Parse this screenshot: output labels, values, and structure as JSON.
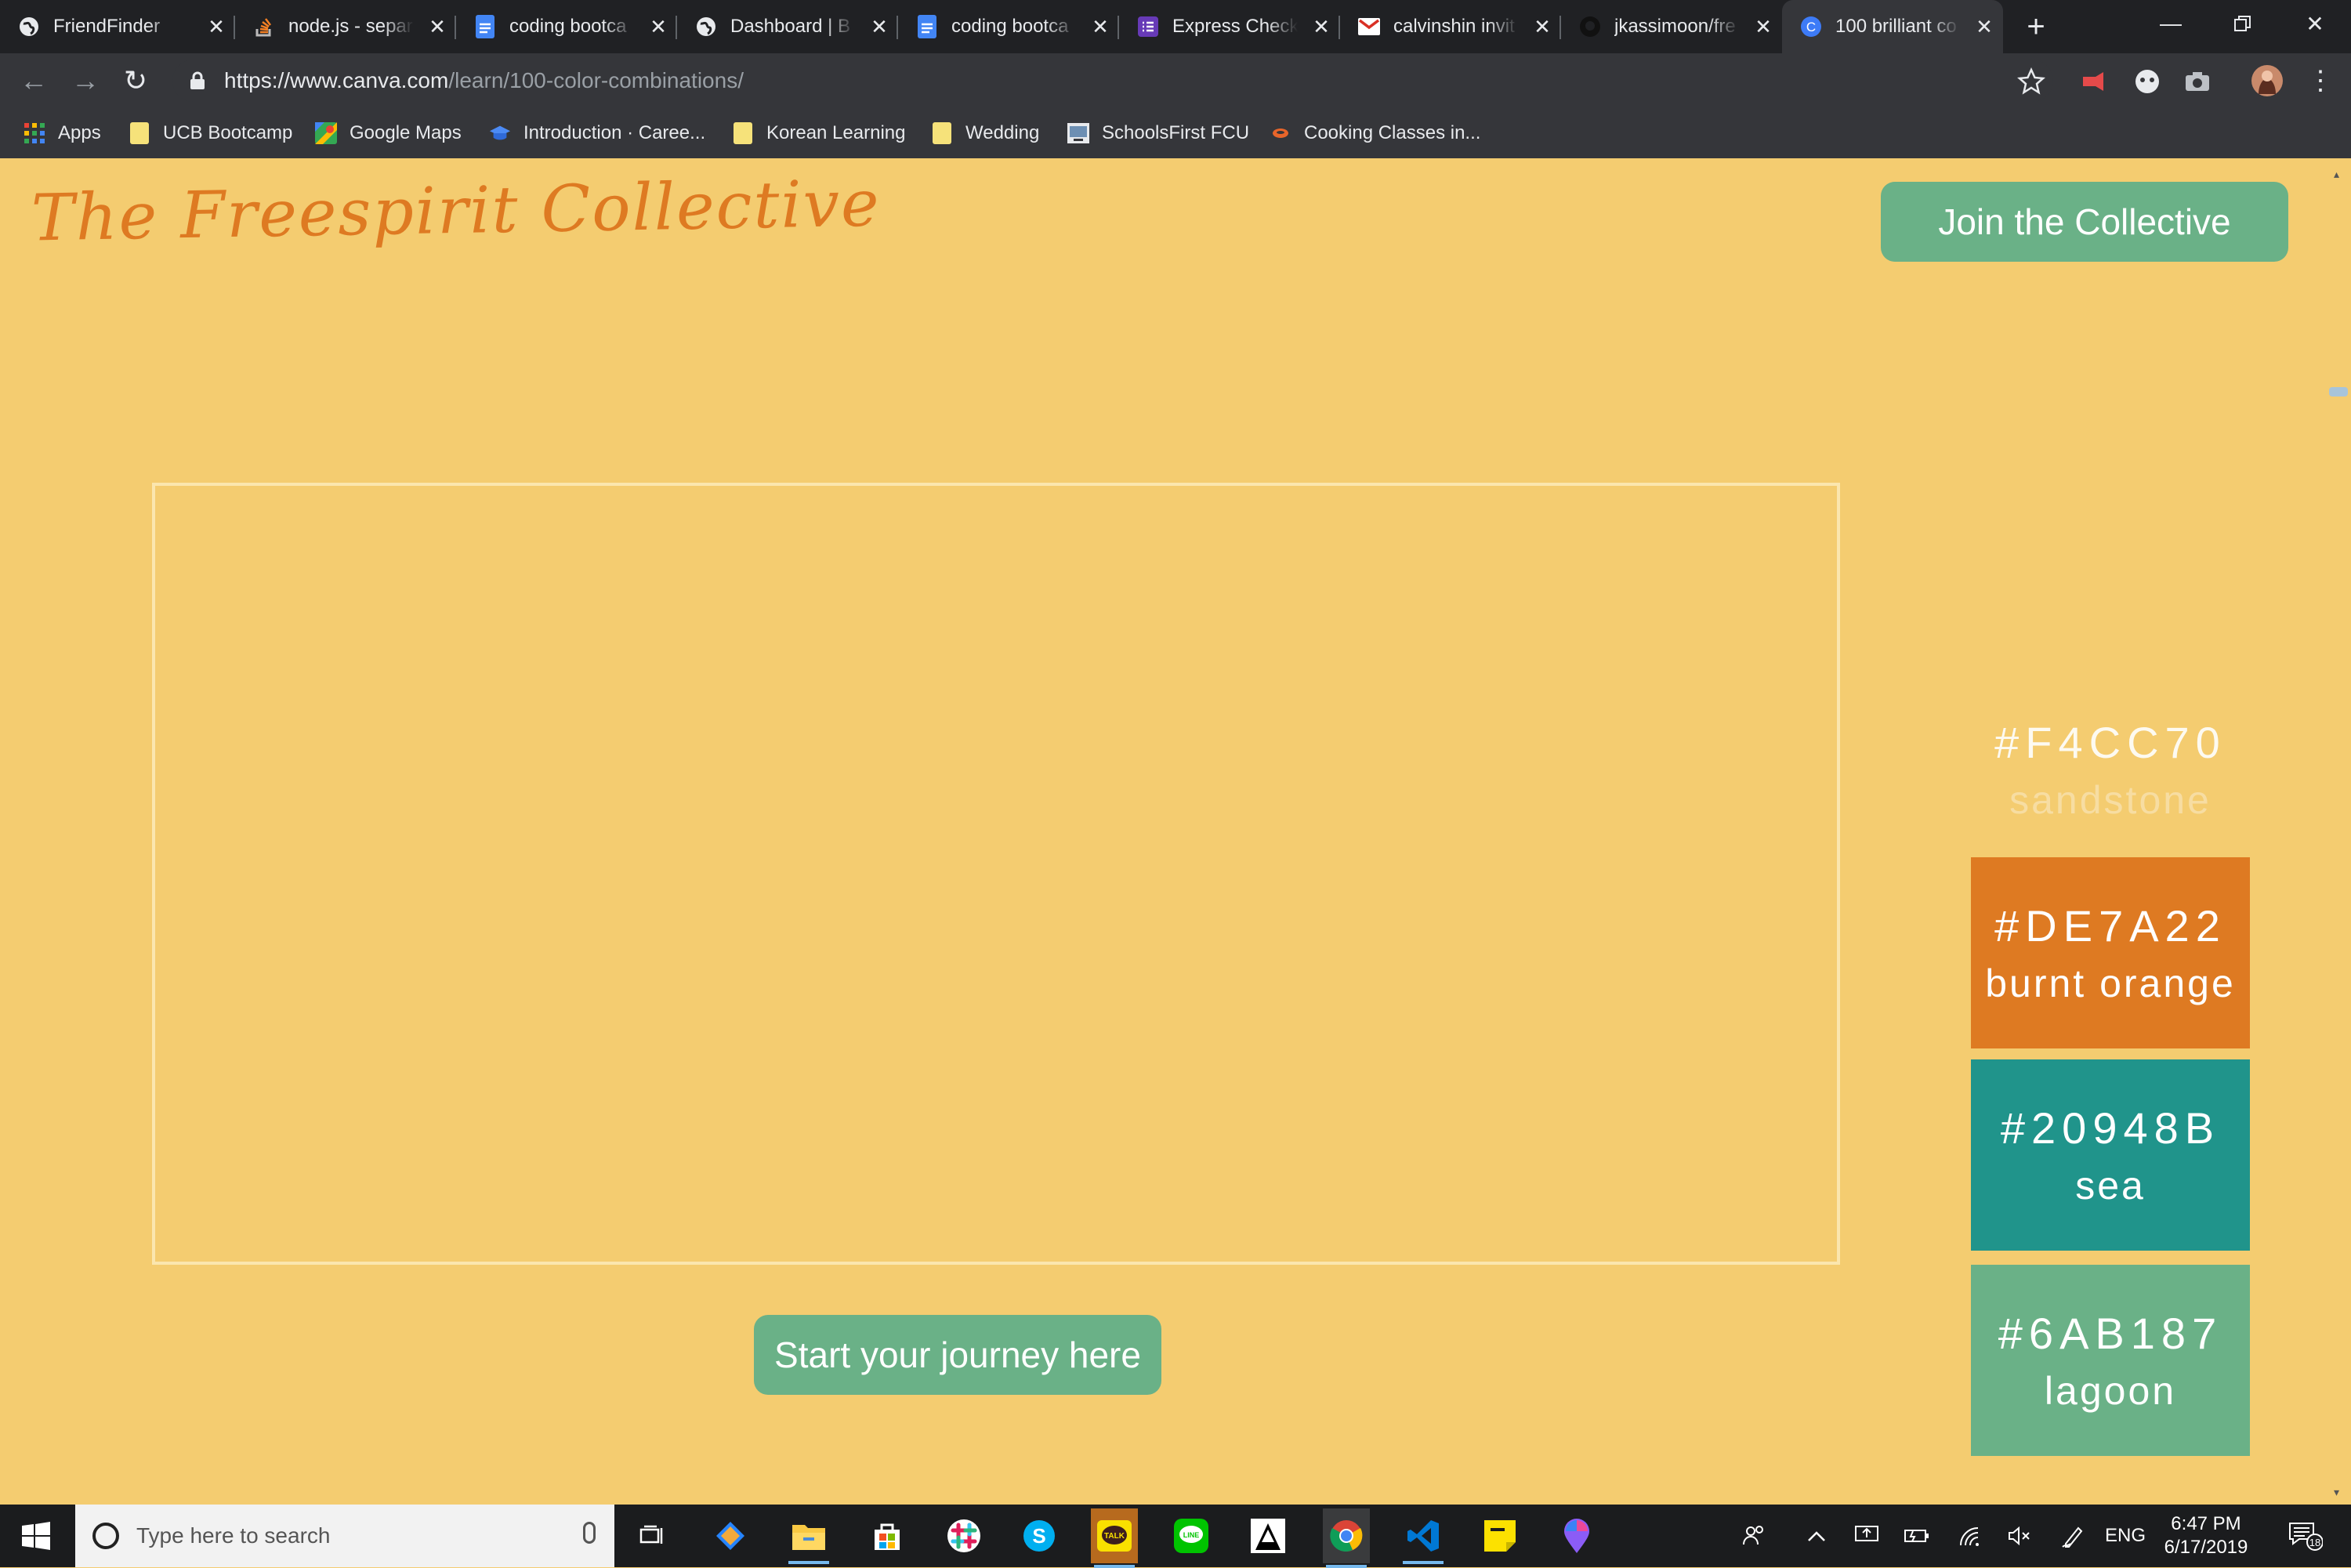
{
  "tabs": [
    {
      "title": "FriendFinder",
      "icon": "globe-icon"
    },
    {
      "title": "node.js - separ",
      "icon": "stackoverflow-icon"
    },
    {
      "title": "coding bootca",
      "icon": "google-docs-icon"
    },
    {
      "title": "Dashboard | B",
      "icon": "globe-icon"
    },
    {
      "title": "coding bootca",
      "icon": "google-docs-icon"
    },
    {
      "title": "Express Check",
      "icon": "forms-icon"
    },
    {
      "title": "calvinshin invit",
      "icon": "gmail-icon"
    },
    {
      "title": "jkassimoon/fre",
      "icon": "github-icon"
    },
    {
      "title": "100 brilliant co",
      "icon": "canva-icon",
      "active": true
    }
  ],
  "toolbar": {
    "url_host": "https://www.canva.com",
    "url_path": "/learn/100-color-combinations/"
  },
  "bookmarks": [
    {
      "label": "Apps",
      "icon": "apps-grid-icon"
    },
    {
      "label": "UCB Bootcamp",
      "icon": "folder-icon"
    },
    {
      "label": "Google Maps",
      "icon": "google-maps-icon"
    },
    {
      "label": "Introduction · Caree...",
      "icon": "bookmark-icon"
    },
    {
      "label": "Korean Learning",
      "icon": "folder-icon"
    },
    {
      "label": "Wedding",
      "icon": "folder-icon"
    },
    {
      "label": "SchoolsFirst FCU",
      "icon": "bank-icon"
    },
    {
      "label": "Cooking Classes in...",
      "icon": "cooking-icon"
    }
  ],
  "page": {
    "brand": "The Freespirit Collective",
    "join_button": "Join the Collective",
    "start_button": "Start your journey here",
    "swatches": [
      {
        "hex": "#F4CC70",
        "name": "sandstone",
        "color": "#F4CC70"
      },
      {
        "hex": "#DE7A22",
        "name": "burnt orange",
        "color": "#DE7A22"
      },
      {
        "hex": "#20948B",
        "name": "sea",
        "color": "#20948B"
      },
      {
        "hex": "#6AB187",
        "name": "lagoon",
        "color": "#6AB187"
      }
    ]
  },
  "taskbar": {
    "search_placeholder": "Type here to search",
    "language": "ENG",
    "time": "6:47 PM",
    "date": "6/17/2019",
    "notification_count": "18",
    "apps": [
      "task-view-icon",
      "sourcetree-icon",
      "file-explorer-icon",
      "store-icon",
      "slack-icon",
      "skype-icon",
      "kakaotalk-icon",
      "line-icon",
      "inkscape-icon",
      "chrome-icon",
      "vscode-icon",
      "sticky-notes-icon",
      "maps-pin-icon"
    ]
  }
}
